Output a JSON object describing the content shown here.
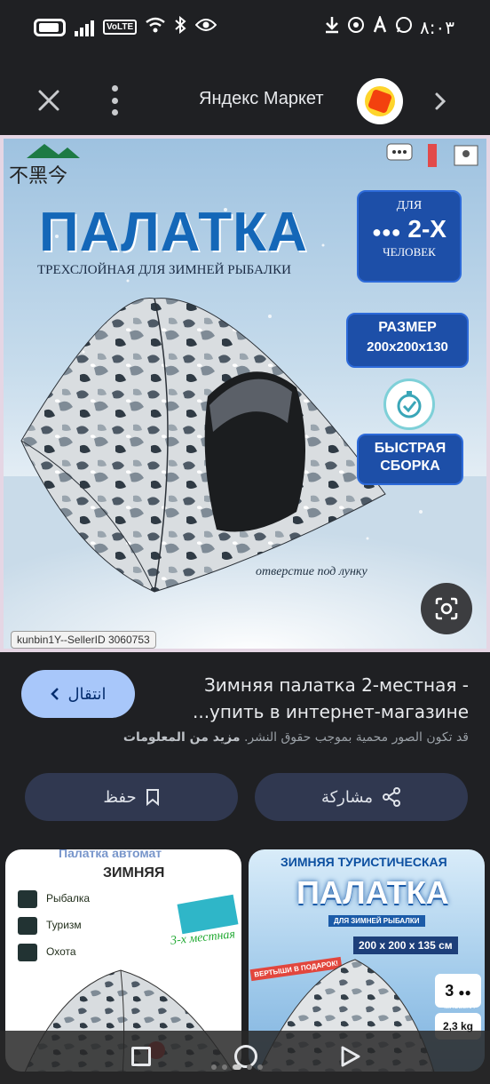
{
  "status_bar": {
    "time": "٨:٠٣",
    "volte": "VoLTE"
  },
  "topbar": {
    "site_title": "Яндекс Маркет"
  },
  "main_image": {
    "title": "ПАЛАТКА",
    "subtitle": "ТРЕХСЛОЙНАЯ ДЛЯ ЗИМНЕЙ РЫБАЛКИ",
    "badge_people": {
      "line1": "ДЛЯ",
      "line2": "2-Х",
      "line3": "ЧЕЛОВЕК"
    },
    "badge_size": {
      "line1": "РАЗМЕР",
      "line2": "200x200x130"
    },
    "badge_fast": {
      "line1": "БЫСТРАЯ",
      "line2": "СБОРКА"
    },
    "hole_caption": "отверстие под лунку",
    "seller_tag": "kunbin1Y--SellerID 3060753",
    "brand_text": "不黑今"
  },
  "result": {
    "visit_label": "انتقال",
    "title": "Зимняя палатка 2-местная - ...упить в интернет-магазине",
    "copyright_text": "قد تكون الصور محمية بموجب حقوق النشر.",
    "more_info": "مزيد من المعلومات",
    "save_label": "حفظ",
    "share_label": "مشاركة"
  },
  "thumb1": {
    "title": "ЗИМНЯЯ",
    "header": "Палатка автомат",
    "items": [
      "Рыбалка",
      "Туризм",
      "Охота"
    ],
    "side_text": "3-х местная"
  },
  "thumb2": {
    "top": "ЗИМНЯЯ ТУРИСТИЧЕСКАЯ",
    "title": "ПАЛАТКА",
    "band": "ДЛЯ ЗИМНЕЙ РЫБАЛКИ",
    "size": "200 x 200 x 135 см",
    "gift": "ВЕРТЫШИ В ПОДАРОК!",
    "people": "3",
    "people_label": "ЧЕЛОВЕКА",
    "weight": "2,3 kg"
  }
}
